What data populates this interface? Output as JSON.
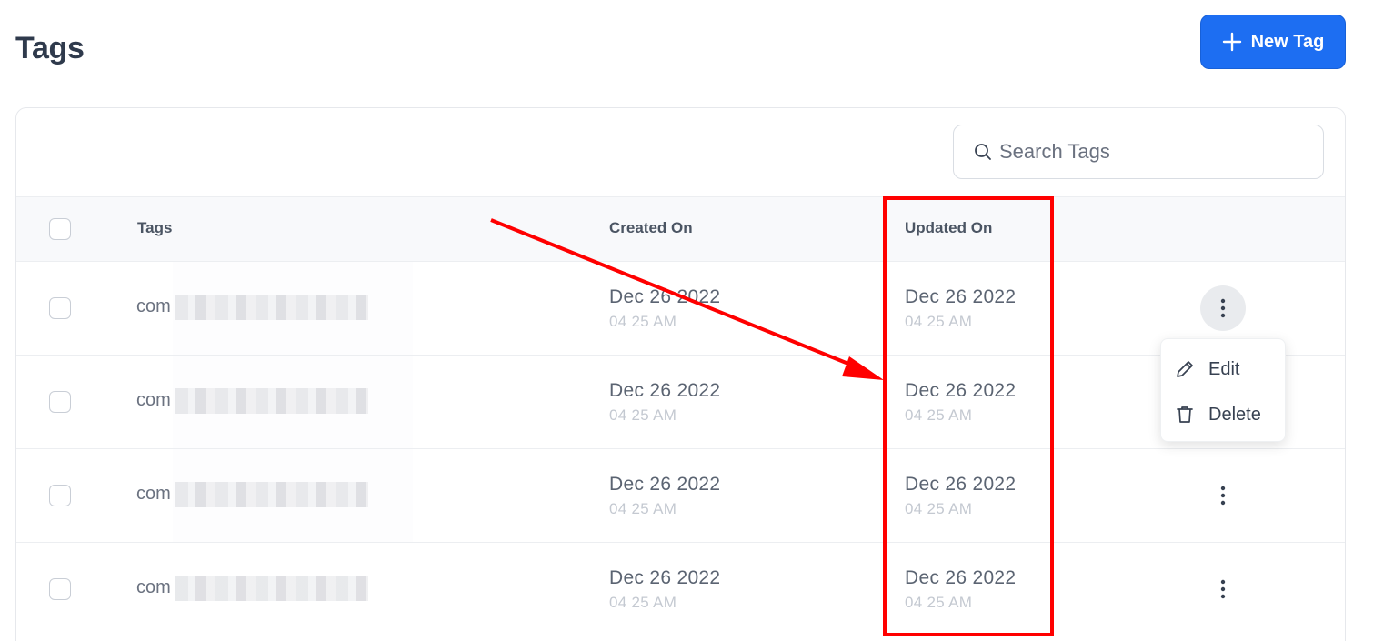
{
  "page": {
    "title": "Tags"
  },
  "toolbar": {
    "new_label": "New Tag"
  },
  "search": {
    "placeholder": "Search Tags"
  },
  "table": {
    "headers": {
      "tags": "Tags",
      "created": "Created On",
      "updated": "Updated On"
    },
    "rows": [
      {
        "tag_prefix": "com",
        "created_date": "Dec 26 2022",
        "created_time": "04 25 AM",
        "updated_date": "Dec 26 2022",
        "updated_time": "04 25 AM"
      },
      {
        "tag_prefix": "com",
        "created_date": "Dec 26 2022",
        "created_time": "04 25 AM",
        "updated_date": "Dec 26 2022",
        "updated_time": "04 25 AM"
      },
      {
        "tag_prefix": "com",
        "created_date": "Dec 26 2022",
        "created_time": "04 25 AM",
        "updated_date": "Dec 26 2022",
        "updated_time": "04 25 AM"
      },
      {
        "tag_prefix": "com",
        "created_date": "Dec 26 2022",
        "created_time": "04 25 AM",
        "updated_date": "Dec 26 2022",
        "updated_time": "04 25 AM"
      }
    ]
  },
  "row_menu": {
    "edit_label": "Edit",
    "delete_label": "Delete"
  },
  "colors": {
    "accent": "#1d6ef2",
    "annotation": "#ff0000"
  },
  "icons": {
    "add": "plus-icon",
    "search": "search-icon",
    "more": "kebab-icon",
    "edit": "pencil-icon",
    "delete": "trash-icon"
  }
}
